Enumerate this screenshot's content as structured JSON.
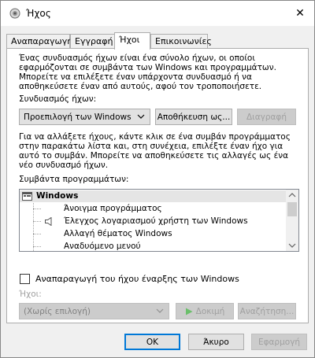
{
  "window": {
    "title": "Ήχος",
    "close_glyph": "✕"
  },
  "tabs": [
    {
      "label": "Αναπαραγωγή"
    },
    {
      "label": "Εγγραφή"
    },
    {
      "label": "Ήχοι"
    },
    {
      "label": "Επικοινωνίες"
    }
  ],
  "sounds_tab": {
    "description": "Ένας συνδυασμός ήχων είναι ένα σύνολο ήχων, οι οποίοι\nεφαρμόζονται σε συμβάντα των Windows και προγραμμάτων.\nΜπορείτε να επιλέξετε έναν υπάρχοντα συνδυασμό ή να\nαποθηκεύσετε έναν από αυτούς, αφού τον τροποποιήσετε.",
    "scheme_label": "Συνδυασμός ήχων:",
    "scheme_value": "Προεπιλογή των Windows",
    "save_as_label": "Αποθήκευση ως...",
    "delete_label": "Διαγραφή",
    "instructions": "Για να αλλάξετε ήχους, κάντε κλικ σε ένα συμβάν προγράμματος\nστην παρακάτω λίστα και, στη συνέχεια, επιλέξτε έναν ήχο για\nαυτό το συμβάν. Μπορείτε να αποθηκεύσετε τις αλλαγές ως ένα\nνέο συνδυασμό ήχων.",
    "events_label": "Συμβάντα προγραμμάτων:",
    "events": {
      "root": "Windows",
      "items": [
        {
          "label": "Άνοιγμα προγράμματος",
          "has_sound": false
        },
        {
          "label": "Έλεγχος λογαριασμού χρήστη των Windows",
          "has_sound": true
        },
        {
          "label": "Αλλαγή θέματος Windows",
          "has_sound": false
        },
        {
          "label": "Αναδυόμενο μενού",
          "has_sound": false
        }
      ]
    },
    "startup_checkbox_label": "Αναπαραγωγή του ήχου έναρξης των Windows",
    "startup_checked": false,
    "sounds_label": "Ήχοι:",
    "sound_value": "(Χωρίς επιλογή)",
    "test_label": "Δοκιμή",
    "browse_label": "Αναζήτηση..."
  },
  "footer": {
    "ok_label": "OK",
    "cancel_label": "Άκυρο",
    "apply_label": "Εφαρμογή"
  }
}
